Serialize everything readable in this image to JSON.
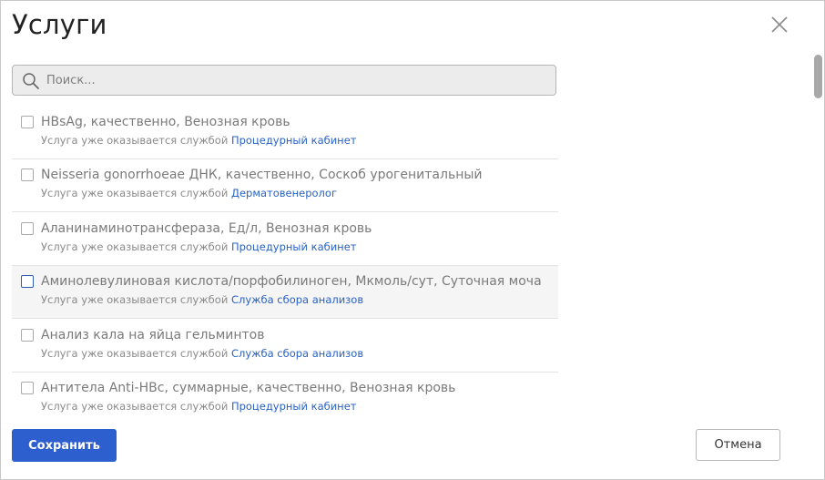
{
  "dialog": {
    "title": "Услуги",
    "close_icon": "close-icon"
  },
  "search": {
    "placeholder": "Поиск...",
    "value": "",
    "icon": "search-icon"
  },
  "services": [
    {
      "name": "HBsAg, качественно, Венозная кровь",
      "note": "Услуга уже оказывается службой",
      "department": "Процедурный кабинет",
      "checked": false
    },
    {
      "name": "Neisseria gonorrhoeae ДНК, качественно, Соскоб урогенитальный",
      "note": "Услуга уже оказывается службой",
      "department": "Дерматовенеролог",
      "checked": false
    },
    {
      "name": "Аланинаминотрансфераза, Ед/л, Венозная кровь",
      "note": "Услуга уже оказывается службой",
      "department": "Процедурный кабинет",
      "checked": false
    },
    {
      "name": "Аминолевулиновая кислота/порфобилиноген, Мкмоль/сут, Суточная моча",
      "note": "Услуга уже оказывается службой",
      "department": "Служба сбора анализов",
      "checked": false
    },
    {
      "name": "Анализ кала на яйца гельминтов",
      "note": "Услуга уже оказывается службой",
      "department": "Служба сбора анализов",
      "checked": false
    },
    {
      "name": "Антитела Anti-HBc, суммарные, качественно, Венозная кровь",
      "note": "Услуга уже оказывается службой",
      "department": "Процедурный кабинет",
      "checked": false
    }
  ],
  "footer": {
    "save_label": "Сохранить",
    "cancel_label": "Отмена"
  },
  "colors": {
    "primary": "#2d5fcf",
    "link": "#2a62c3",
    "hover_row": "#f5f5f5"
  }
}
